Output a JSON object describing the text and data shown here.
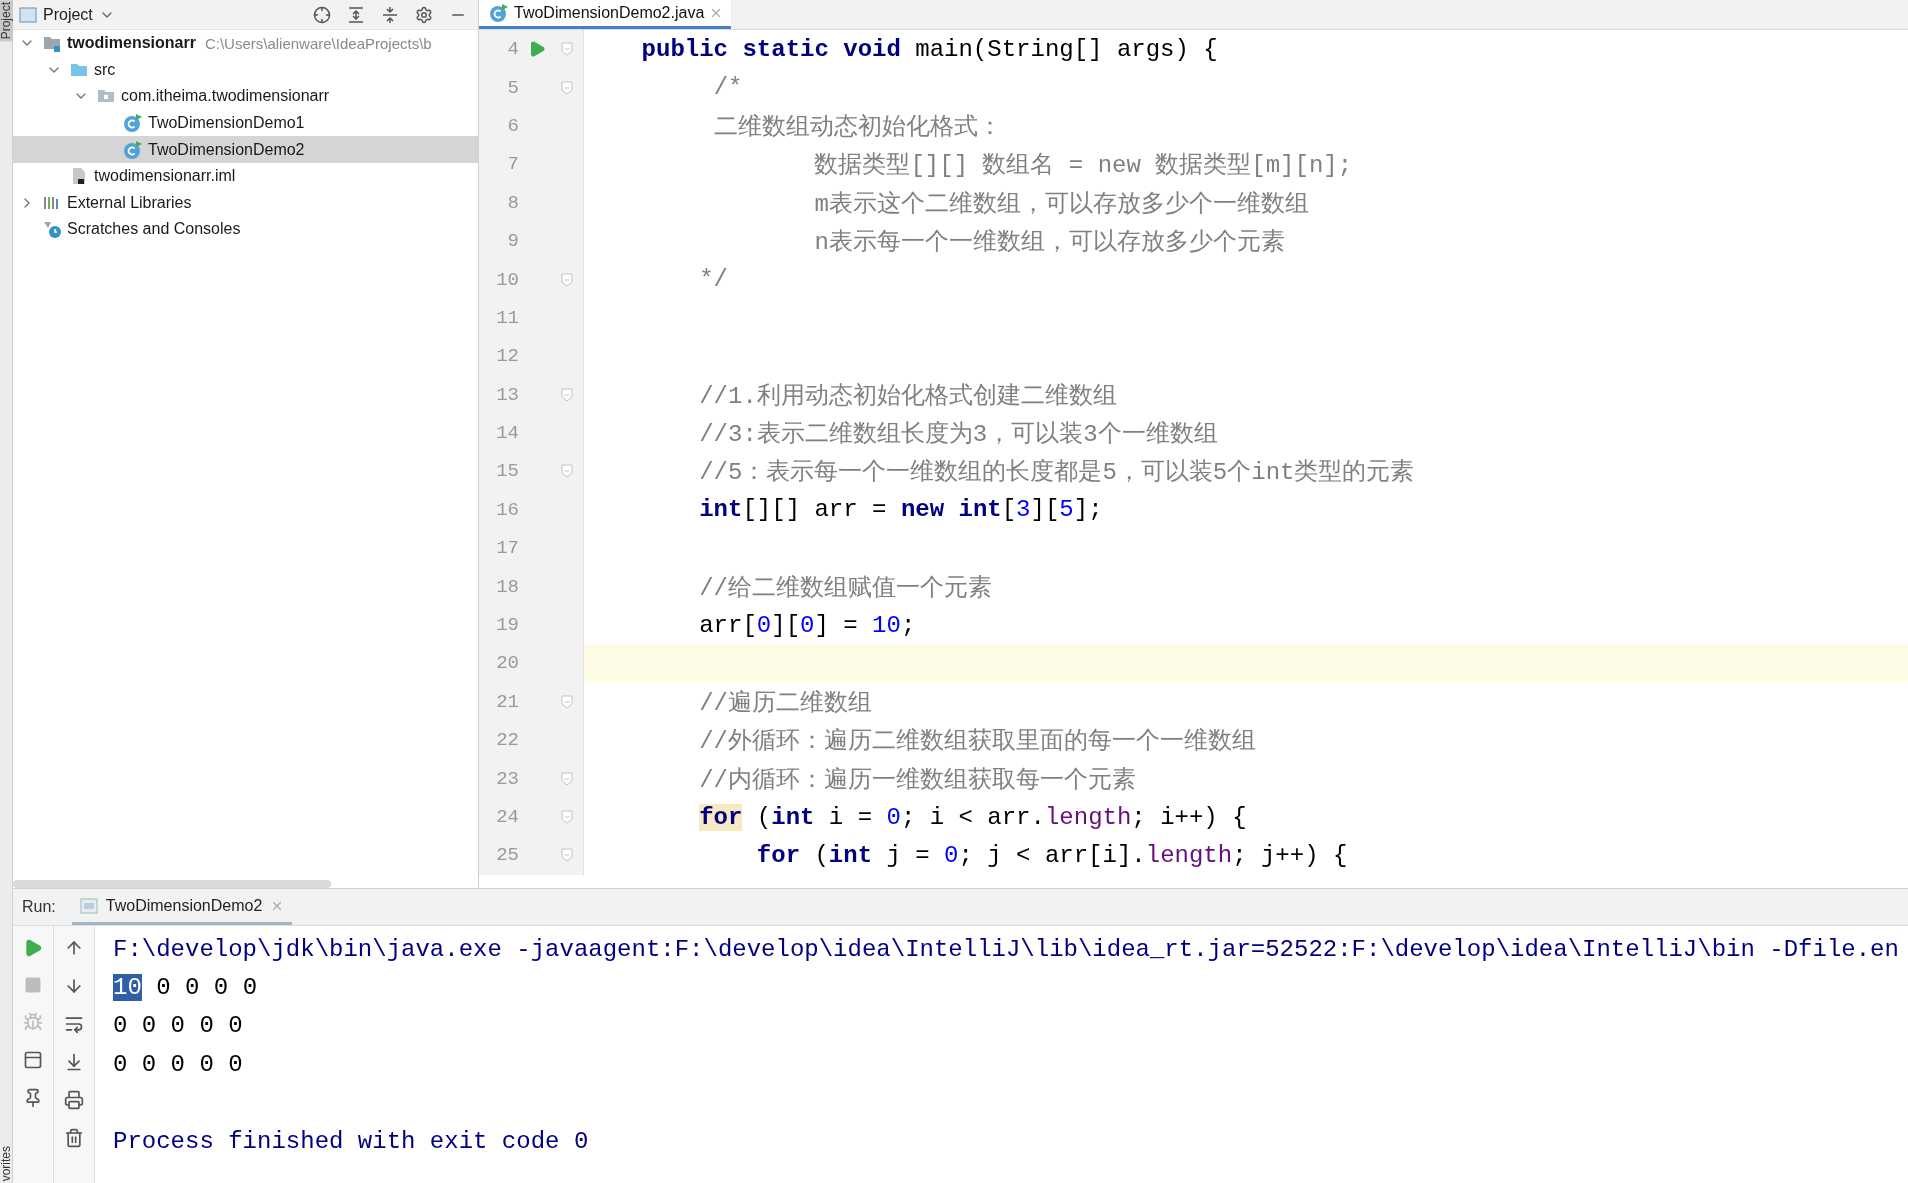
{
  "side_strip": {
    "top_label": "Project",
    "bottom_label": "vorites"
  },
  "project_panel": {
    "title": "Project",
    "tree": [
      {
        "label": "twodimensionarr",
        "hint": "C:\\Users\\alienware\\IdeaProjects\\b",
        "kind": "module",
        "expanded": true,
        "selected": false,
        "children": [
          {
            "label": "src",
            "kind": "folder",
            "expanded": true,
            "selected": false,
            "children": [
              {
                "label": "com.itheima.twodimensionarr",
                "kind": "package",
                "expanded": true,
                "selected": false,
                "children": [
                  {
                    "label": "TwoDimensionDemo1",
                    "kind": "class",
                    "selected": false
                  },
                  {
                    "label": "TwoDimensionDemo2",
                    "kind": "class",
                    "selected": true
                  }
                ]
              }
            ]
          },
          {
            "label": "twodimensionarr.iml",
            "kind": "file",
            "selected": false
          }
        ]
      },
      {
        "label": "External Libraries",
        "kind": "libraries",
        "expanded": false,
        "selected": false
      },
      {
        "label": "Scratches and Consoles",
        "kind": "scratches",
        "selected": false
      }
    ]
  },
  "editor": {
    "tabs": [
      {
        "label": "TwoDimensionDemo2.java",
        "selected": true
      }
    ],
    "lines": [
      {
        "number": "4",
        "run": true,
        "fold": true,
        "current": false,
        "tokens": [
          {
            "text": "    public static void",
            "kind": "keyword"
          },
          {
            "text": " main(String[] args) {",
            "kind": "plain"
          }
        ]
      },
      {
        "number": "5",
        "run": false,
        "fold": true,
        "current": false,
        "tokens": [
          {
            "text": "         /*",
            "kind": "comment"
          }
        ]
      },
      {
        "number": "6",
        "run": false,
        "fold": false,
        "current": false,
        "tokens": [
          {
            "text": "         二维数组动态初始化格式：",
            "kind": "comment"
          }
        ]
      },
      {
        "number": "7",
        "run": false,
        "fold": false,
        "current": false,
        "tokens": [
          {
            "text": "                数据类型[][] 数组名 = new 数据类型[m][n];",
            "kind": "comment"
          }
        ]
      },
      {
        "number": "8",
        "run": false,
        "fold": false,
        "current": false,
        "tokens": [
          {
            "text": "                m表示这个二维数组，可以存放多少个一维数组",
            "kind": "comment"
          }
        ]
      },
      {
        "number": "9",
        "run": false,
        "fold": false,
        "current": false,
        "tokens": [
          {
            "text": "                n表示每一个一维数组，可以存放多少个元素",
            "kind": "comment"
          }
        ]
      },
      {
        "number": "10",
        "run": false,
        "fold": true,
        "current": false,
        "tokens": [
          {
            "text": "        */",
            "kind": "comment"
          }
        ]
      },
      {
        "number": "11",
        "run": false,
        "fold": false,
        "current": false
      },
      {
        "number": "12",
        "run": false,
        "fold": false,
        "current": false
      },
      {
        "number": "13",
        "run": false,
        "fold": true,
        "current": false,
        "tokens": [
          {
            "text": "        //1.利用动态初始化格式创建二维数组",
            "kind": "comment"
          }
        ]
      },
      {
        "number": "14",
        "run": false,
        "fold": false,
        "current": false,
        "tokens": [
          {
            "text": "        //3:表示二维数组长度为3，可以装3个一维数组",
            "kind": "comment"
          }
        ]
      },
      {
        "number": "15",
        "run": false,
        "fold": true,
        "current": false,
        "tokens": [
          {
            "text": "        //5：表示每一个一维数组的长度都是5，可以装5个int类型的元素",
            "kind": "comment"
          }
        ]
      },
      {
        "number": "16",
        "run": false,
        "fold": false,
        "current": false,
        "tokens": [
          {
            "text": "        int",
            "kind": "keyword"
          },
          {
            "text": "[][] arr = ",
            "kind": "plain"
          },
          {
            "text": "new int",
            "kind": "keyword"
          },
          {
            "text": "[",
            "kind": "plain"
          },
          {
            "text": "3",
            "kind": "number"
          },
          {
            "text": "][",
            "kind": "plain"
          },
          {
            "text": "5",
            "kind": "number"
          },
          {
            "text": "];",
            "kind": "plain"
          }
        ]
      },
      {
        "number": "17",
        "run": false,
        "fold": false,
        "current": false
      },
      {
        "number": "18",
        "run": false,
        "fold": false,
        "current": false,
        "tokens": [
          {
            "text": "        //给二维数组赋值一个元素",
            "kind": "comment"
          }
        ]
      },
      {
        "number": "19",
        "run": false,
        "fold": false,
        "current": false,
        "tokens": [
          {
            "text": "        arr[",
            "kind": "plain"
          },
          {
            "text": "0",
            "kind": "number"
          },
          {
            "text": "][",
            "kind": "plain"
          },
          {
            "text": "0",
            "kind": "number"
          },
          {
            "text": "] = ",
            "kind": "plain"
          },
          {
            "text": "10",
            "kind": "number"
          },
          {
            "text": ";",
            "kind": "plain"
          }
        ]
      },
      {
        "number": "20",
        "run": false,
        "fold": false,
        "current": true
      },
      {
        "number": "21",
        "run": false,
        "fold": true,
        "current": false,
        "tokens": [
          {
            "text": "        //遍历二维数组",
            "kind": "comment"
          }
        ]
      },
      {
        "number": "22",
        "run": false,
        "fold": false,
        "current": false,
        "tokens": [
          {
            "text": "        //外循环：遍历二维数组获取里面的每一个一维数组",
            "kind": "comment"
          }
        ]
      },
      {
        "number": "23",
        "run": false,
        "fold": true,
        "current": false,
        "tokens": [
          {
            "text": "        //内循环：遍历一维数组获取每一个元素",
            "kind": "comment"
          }
        ]
      },
      {
        "number": "24",
        "run": false,
        "fold": true,
        "current": false,
        "tokens": [
          {
            "text": "        for",
            "kind": "keyword_marked"
          },
          {
            "text": " (",
            "kind": "plain"
          },
          {
            "text": "int",
            "kind": "keyword"
          },
          {
            "text": " i = ",
            "kind": "plain"
          },
          {
            "text": "0",
            "kind": "number"
          },
          {
            "text": "; i < arr.",
            "kind": "plain"
          },
          {
            "text": "length",
            "kind": "field"
          },
          {
            "text": "; i++) {",
            "kind": "plain"
          }
        ]
      },
      {
        "number": "25",
        "run": false,
        "fold": true,
        "current": false,
        "tokens": [
          {
            "text": "            for",
            "kind": "keyword"
          },
          {
            "text": " (",
            "kind": "plain"
          },
          {
            "text": "int",
            "kind": "keyword"
          },
          {
            "text": " j = ",
            "kind": "plain"
          },
          {
            "text": "0",
            "kind": "number"
          },
          {
            "text": "; j < arr[i].",
            "kind": "plain"
          },
          {
            "text": "length",
            "kind": "field"
          },
          {
            "text": "; j++) {",
            "kind": "plain"
          }
        ]
      }
    ]
  },
  "run_panel": {
    "label": "Run:",
    "tabs": [
      {
        "label": "TwoDimensionDemo2",
        "selected": true
      }
    ],
    "toolbar": [
      {
        "kind": "rerun",
        "disabled": false
      },
      {
        "kind": "stop",
        "disabled": true
      },
      {
        "kind": "debug",
        "disabled": true
      },
      {
        "kind": "layout",
        "disabled": false
      },
      {
        "kind": "pin",
        "disabled": false
      }
    ],
    "console_tools": [
      {
        "kind": "up"
      },
      {
        "kind": "down"
      },
      {
        "kind": "wrap"
      },
      {
        "kind": "scroll_end"
      },
      {
        "kind": "print"
      },
      {
        "kind": "trash"
      }
    ],
    "console": [
      {
        "kind": "system",
        "segments": [
          {
            "text": "F:\\develop\\jdk\\bin\\java.exe -javaagent:F:\\develop\\idea\\IntelliJ\\lib\\idea_rt.jar=52522:F:\\develop\\idea\\IntelliJ\\bin -Dfile.en",
            "selected": false
          }
        ]
      },
      {
        "kind": "output",
        "segments": [
          {
            "text": "10",
            "selected": true
          },
          {
            "text": " 0 0 0 0",
            "selected": false
          }
        ]
      },
      {
        "kind": "output",
        "segments": [
          {
            "text": "0 0 0 0 0",
            "selected": false
          }
        ]
      },
      {
        "kind": "output",
        "segments": [
          {
            "text": "0 0 0 0 0",
            "selected": false
          }
        ]
      },
      {
        "kind": "blank"
      },
      {
        "kind": "system",
        "segments": [
          {
            "text": "Process finished with exit code 0",
            "selected": false
          }
        ]
      }
    ]
  }
}
